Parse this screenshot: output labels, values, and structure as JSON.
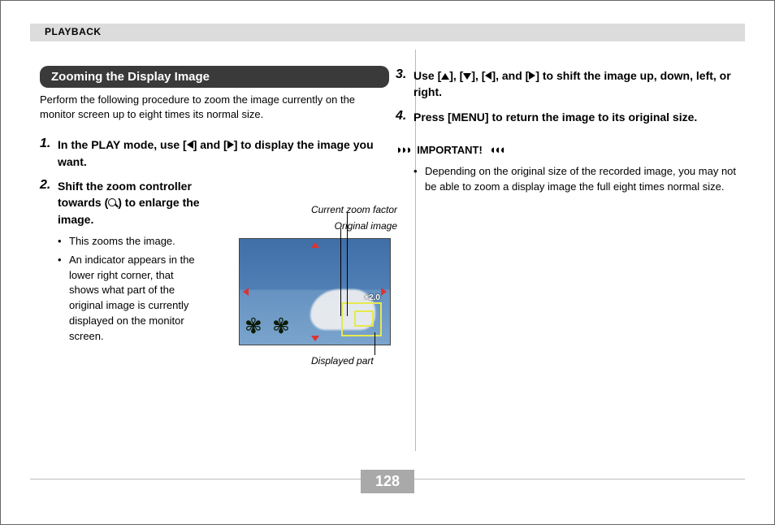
{
  "page_number": "128",
  "chapter": "PLAYBACK",
  "section_title": "Zooming the Display Image",
  "intro": "Perform the following procedure to zoom the image currently on the monitor screen up to eight times its normal size.",
  "steps": {
    "s1": {
      "num": "1.",
      "text_a": "In the PLAY mode, use [",
      "text_b": "] and [",
      "text_c": "] to display the image you want."
    },
    "s2": {
      "num": "2.",
      "text_a": "Shift the zoom controller towards (",
      "text_b": ") to enlarge the image.",
      "sub1": "This zooms the image.",
      "sub2": "An indicator appears in the lower right corner, that shows what part of the original image is currently displayed on the monitor screen."
    },
    "s3": {
      "num": "3.",
      "text_a": "Use [",
      "text_b": "], [",
      "text_c": "], [",
      "text_d": "], and [",
      "text_e": "] to shift the image up, down, left, or right."
    },
    "s4": {
      "num": "4.",
      "text": "Press [MENU] to return the image to its original size."
    }
  },
  "important": {
    "label": "IMPORTANT!",
    "note": "Depending on the original size of the recorded image, you may not be able to zoom a display image the full eight times normal size."
  },
  "figure": {
    "label_zoom_factor": "Current zoom factor",
    "label_original": "Original image",
    "label_displayed": "Displayed part",
    "zoom_value": "×2.0"
  }
}
